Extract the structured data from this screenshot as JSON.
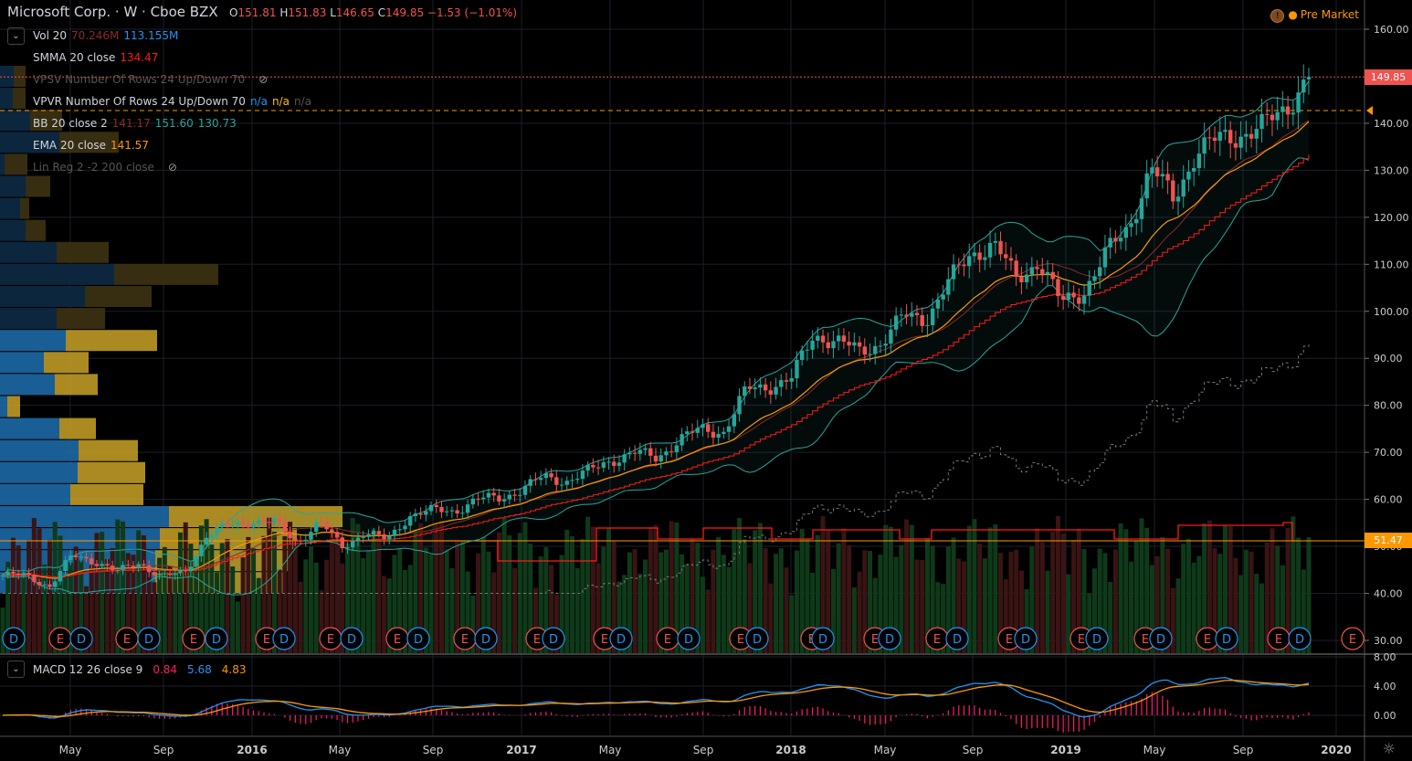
{
  "header": {
    "title": "Microsoft Corp. · W · Cboe BZX",
    "open_label": "O",
    "open": "151.81",
    "high_label": "H",
    "high": "151.83",
    "low_label": "L",
    "low": "146.65",
    "close_label": "C",
    "close": "149.85",
    "change": "−1.53 (−1.01%)",
    "pre_market": "Pre Market"
  },
  "indicators": [
    {
      "name": "Vol 20",
      "values": [
        "70.246M",
        "113.155M"
      ],
      "colors": [
        "#8b2a2a",
        "#2196f3"
      ]
    },
    {
      "name": "SMMA 20 close",
      "values": [
        "134.47"
      ],
      "colors": [
        "#ff1a1a"
      ]
    },
    {
      "name": "VPSV Number Of Rows 24 Up/Down 70",
      "values": [],
      "colors": [],
      "hidden": true
    },
    {
      "name": "VPVR Number Of Rows 24 Up/Down 70",
      "values": [
        "n/a",
        "n/a",
        "n/a"
      ],
      "colors": [
        "#2196f3",
        "#ffc107",
        "#555"
      ]
    },
    {
      "name": "BB 20 close 2",
      "values": [
        "141.17",
        "151.60",
        "130.73"
      ],
      "colors": [
        "#8b2a2a",
        "#26a69a",
        "#26a69a"
      ]
    },
    {
      "name": "EMA 20 close",
      "values": [
        "141.57"
      ],
      "colors": [
        "#ff9800"
      ]
    },
    {
      "name": "Lin Reg 2 -2 200 close",
      "values": [],
      "colors": [],
      "hidden": true
    }
  ],
  "macd": {
    "name": "MACD 12 26 close 9",
    "values": [
      "0.84",
      "5.68",
      "4.83"
    ],
    "colors": [
      "#ff1a6c",
      "#2196f3",
      "#ff9800"
    ],
    "axis": [
      "8.00",
      "4.00",
      "0.00"
    ]
  },
  "price_labels": {
    "last": "149.85",
    "level": "51.47"
  },
  "chart_data": {
    "type": "candlestick",
    "title": "Microsoft Corp. · W · Cboe BZX",
    "ylim": [
      30,
      160
    ],
    "y_ticks": [
      "160.00",
      "140.00",
      "130.00",
      "120.00",
      "110.00",
      "100.00",
      "90.00",
      "80.00",
      "70.00",
      "60.00",
      "50.00",
      "40.00",
      "30.00"
    ],
    "y_tick_values": [
      160,
      140,
      130,
      120,
      110,
      100,
      90,
      80,
      70,
      60,
      50,
      40,
      30
    ],
    "x_ticks": [
      "May",
      "Sep",
      "2016",
      "May",
      "Sep",
      "2017",
      "May",
      "Sep",
      "2018",
      "May",
      "Sep",
      "2019",
      "May",
      "Sep",
      "2020"
    ],
    "monthly_close_from_feb_2015": [
      43.8,
      41.5,
      48,
      47,
      44.5,
      46.6,
      43.5,
      44.3,
      52.6,
      54.4,
      55.5,
      55,
      50.9,
      55.2,
      49.9,
      53,
      51.2,
      56.7,
      57.5,
      57.6,
      59.9,
      60.3,
      62.1,
      64.7,
      64,
      65.9,
      68.5,
      69.8,
      68.9,
      72.7,
      74.8,
      74.5,
      83.2,
      84.2,
      85.5,
      95,
      93.8,
      91.3,
      93.5,
      98.8,
      98.6,
      106,
      112.3,
      114.4,
      106.8,
      110.9,
      101.6,
      104.4,
      112,
      118,
      130.6,
      123.7,
      134,
      136.3,
      137.9,
      139,
      143.4,
      149.85
    ],
    "volume_profile_rows_top_to_bottom": [
      [
        15,
        13
      ],
      [
        14,
        14
      ],
      [
        33,
        35
      ],
      [
        65,
        65
      ],
      [
        5,
        25
      ],
      [
        28,
        27
      ],
      [
        22,
        10
      ],
      [
        28,
        22
      ],
      [
        62,
        57
      ],
      [
        125,
        114
      ],
      [
        93,
        73
      ],
      [
        62,
        53
      ],
      [
        72,
        100
      ],
      [
        48,
        49
      ],
      [
        60,
        47
      ],
      [
        8,
        14
      ],
      [
        65,
        40
      ],
      [
        86,
        65
      ],
      [
        85,
        74
      ],
      [
        77,
        80
      ],
      [
        185,
        190
      ],
      [
        175,
        150
      ],
      [
        170,
        150
      ],
      [
        170,
        140
      ]
    ],
    "events": {
      "earnings_label": "E",
      "dividend_label": "D"
    }
  }
}
